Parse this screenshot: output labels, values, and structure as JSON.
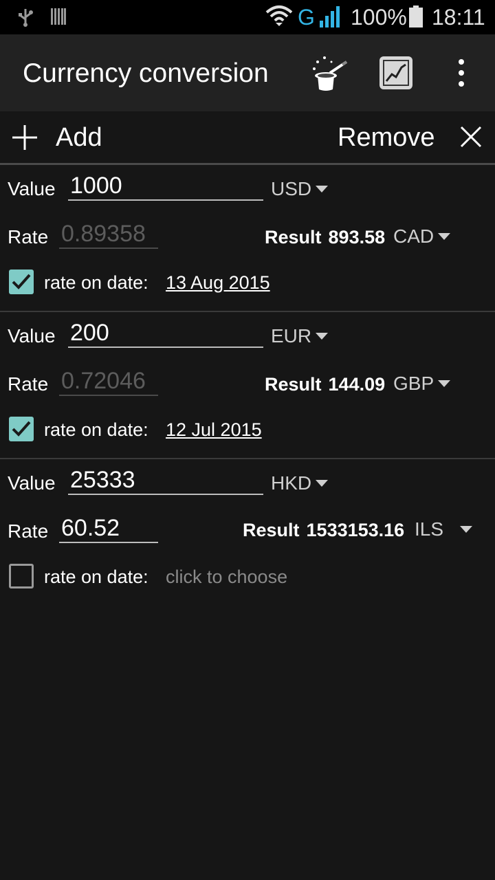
{
  "status_bar": {
    "network_type": "G",
    "battery": "100%",
    "time": "18:11"
  },
  "action_bar": {
    "title": "Currency conversion",
    "icons": [
      "magic-wand-hat-icon",
      "chart-icon",
      "overflow-menu-icon"
    ]
  },
  "toolbar": {
    "add_label": "Add",
    "remove_label": "Remove"
  },
  "labels": {
    "value": "Value",
    "rate": "Rate",
    "result": "Result",
    "rate_on_date": "rate on date:"
  },
  "conversions": [
    {
      "value": "1000",
      "from_currency": "USD",
      "rate": "0.89358",
      "result": "893.58",
      "to_currency": "CAD",
      "rate_on_date_checked": true,
      "date": "13 Aug 2015"
    },
    {
      "value": "200",
      "from_currency": "EUR",
      "rate": "0.72046",
      "result": "144.09",
      "to_currency": "GBP",
      "rate_on_date_checked": true,
      "date": "12 Jul 2015"
    },
    {
      "value": "25333",
      "from_currency": "HKD",
      "rate": "60.52",
      "result": "1533153.16",
      "to_currency": "ILS",
      "rate_on_date_checked": false,
      "date": "click to choose"
    }
  ],
  "colors": {
    "accent": "#33b5e5",
    "checkbox": "#7fcbc6",
    "background": "#161616",
    "action_bar": "#222222"
  }
}
